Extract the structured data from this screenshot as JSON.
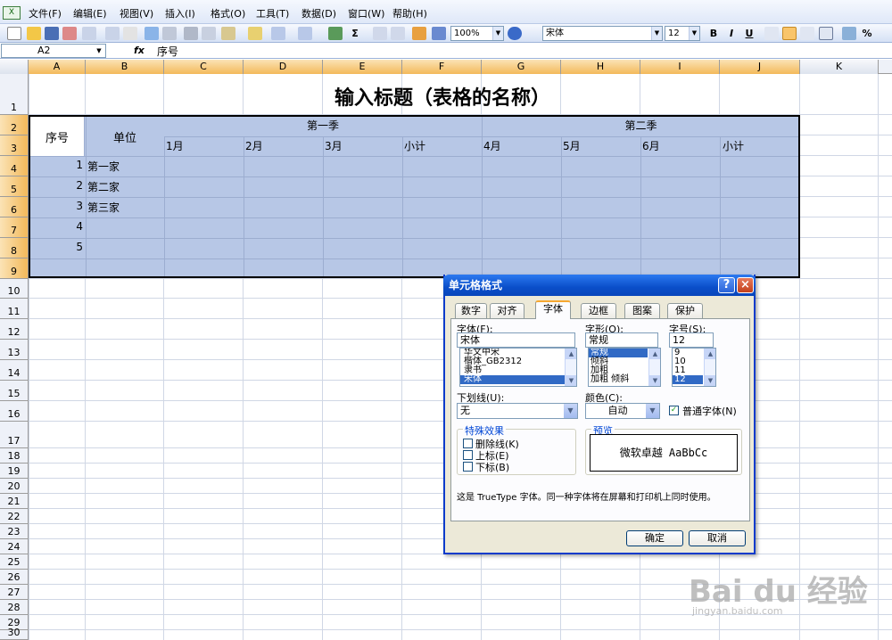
{
  "menubar": {
    "items": [
      "文件(F)",
      "编辑(E)",
      "视图(V)",
      "插入(I)",
      "格式(O)",
      "工具(T)",
      "数据(D)",
      "窗口(W)",
      "帮助(H)"
    ]
  },
  "toolbar": {
    "zoom": "100%",
    "font_name": "宋体",
    "font_size": "12",
    "bold": "B",
    "italic": "I",
    "underline": "U",
    "sigma": "Σ",
    "percent": "%"
  },
  "formula_bar": {
    "name_box": "A2",
    "fx": "fx",
    "value": "序号"
  },
  "columns": [
    "A",
    "B",
    "C",
    "D",
    "E",
    "F",
    "G",
    "H",
    "I",
    "J",
    "K"
  ],
  "rows": [
    "1",
    "2",
    "3",
    "4",
    "5",
    "6",
    "7",
    "8",
    "9",
    "10",
    "11",
    "12",
    "13",
    "14",
    "15",
    "16",
    "17",
    "18",
    "19",
    "20",
    "21",
    "22",
    "23",
    "24",
    "25",
    "26",
    "27",
    "28",
    "29",
    "30"
  ],
  "sheet": {
    "title": "输入标题（表格的名称）",
    "header_seq": "序号",
    "header_unit": "单位",
    "q1": "第一季",
    "q2": "第二季",
    "months": [
      "1月",
      "2月",
      "3月",
      "小计",
      "4月",
      "5月",
      "6月",
      "小计"
    ],
    "seq_numbers": [
      "1",
      "2",
      "3",
      "4",
      "5"
    ],
    "units": [
      "第一家",
      "第二家",
      "第三家"
    ]
  },
  "dialog": {
    "title": "单元格格式",
    "help": "?",
    "close": "×",
    "tabs": [
      "数字",
      "对齐",
      "字体",
      "边框",
      "图案",
      "保护"
    ],
    "font_label": "字体(F):",
    "font_value": "宋体",
    "font_list": [
      "华文中宋",
      "楷体_GB2312",
      "隶书",
      "宋体"
    ],
    "style_label": "字形(O):",
    "style_value": "常规",
    "style_list": [
      "常规",
      "倾斜",
      "加粗",
      "加粗 倾斜"
    ],
    "size_label": "字号(S):",
    "size_value": "12",
    "size_list": [
      "9",
      "10",
      "11",
      "12"
    ],
    "underline_label": "下划线(U):",
    "underline_value": "无",
    "color_label": "颜色(C):",
    "color_value": "自动",
    "normal_font_label": "普通字体(N)",
    "effects_label": "特殊效果",
    "strikethrough": "删除线(K)",
    "superscript": "上标(E)",
    "subscript": "下标(B)",
    "preview_label": "预览",
    "preview_text": "微软卓越  AaBbCc",
    "note": "这是 TrueType 字体。同一种字体将在屏幕和打印机上同时使用。",
    "ok": "确定",
    "cancel": "取消"
  },
  "watermark": {
    "brand": "Bai du 经验",
    "url": "jingyan.baidu.com"
  }
}
